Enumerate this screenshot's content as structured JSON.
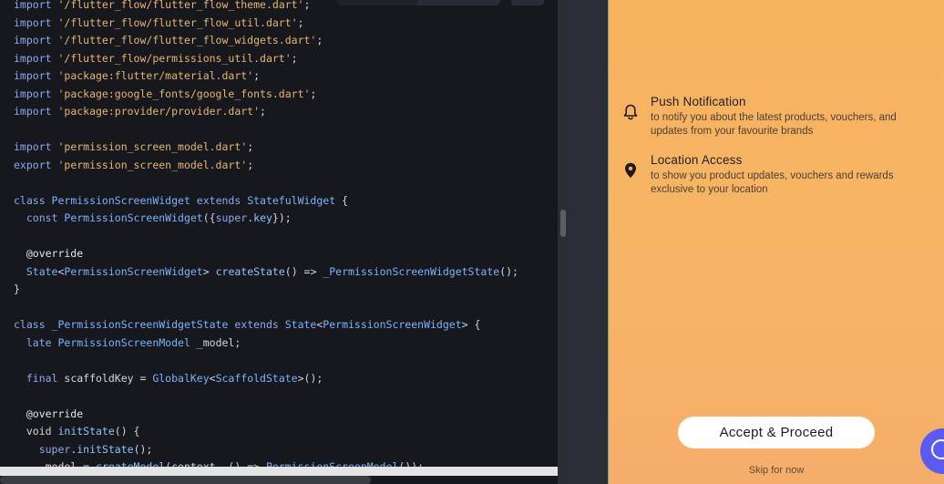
{
  "editor": {
    "lines": [
      [
        {
          "t": "import ",
          "c": "kw"
        },
        {
          "t": "'/flutter_flow/flutter_flow_theme.dart'",
          "c": "str"
        },
        {
          "t": ";",
          "c": "op"
        }
      ],
      [
        {
          "t": "import ",
          "c": "kw"
        },
        {
          "t": "'/flutter_flow/flutter_flow_util.dart'",
          "c": "str"
        },
        {
          "t": ";",
          "c": "op"
        }
      ],
      [
        {
          "t": "import ",
          "c": "kw"
        },
        {
          "t": "'/flutter_flow/flutter_flow_widgets.dart'",
          "c": "str"
        },
        {
          "t": ";",
          "c": "op"
        }
      ],
      [
        {
          "t": "import ",
          "c": "kw"
        },
        {
          "t": "'/flutter_flow/permissions_util.dart'",
          "c": "str"
        },
        {
          "t": ";",
          "c": "op"
        }
      ],
      [
        {
          "t": "import ",
          "c": "kw"
        },
        {
          "t": "'package:flutter/material.dart'",
          "c": "str"
        },
        {
          "t": ";",
          "c": "op"
        }
      ],
      [
        {
          "t": "import ",
          "c": "kw"
        },
        {
          "t": "'package:google_fonts/google_fonts.dart'",
          "c": "str"
        },
        {
          "t": ";",
          "c": "op"
        }
      ],
      [
        {
          "t": "import ",
          "c": "kw"
        },
        {
          "t": "'package:provider/provider.dart'",
          "c": "str"
        },
        {
          "t": ";",
          "c": "op"
        }
      ],
      [],
      [
        {
          "t": "import ",
          "c": "kw"
        },
        {
          "t": "'permission_screen_model.dart'",
          "c": "str"
        },
        {
          "t": ";",
          "c": "op"
        }
      ],
      [
        {
          "t": "export ",
          "c": "kw"
        },
        {
          "t": "'permission_screen_model.dart'",
          "c": "str"
        },
        {
          "t": ";",
          "c": "op"
        }
      ],
      [],
      [
        {
          "t": "class ",
          "c": "kw"
        },
        {
          "t": "PermissionScreenWidget ",
          "c": "ty"
        },
        {
          "t": "extends ",
          "c": "kw"
        },
        {
          "t": "StatefulWidget",
          "c": "ty"
        },
        {
          "t": " {",
          "c": "op"
        }
      ],
      [
        {
          "t": "  const ",
          "c": "kw"
        },
        {
          "t": "PermissionScreenWidget",
          "c": "ty"
        },
        {
          "t": "({",
          "c": "op"
        },
        {
          "t": "super",
          "c": "kw"
        },
        {
          "t": ".",
          "c": "op"
        },
        {
          "t": "key",
          "c": "fn"
        },
        {
          "t": "});",
          "c": "op"
        }
      ],
      [],
      [
        {
          "t": "  @override",
          "c": "an"
        }
      ],
      [
        {
          "t": "  State",
          "c": "ty"
        },
        {
          "t": "<",
          "c": "op"
        },
        {
          "t": "PermissionScreenWidget",
          "c": "ty"
        },
        {
          "t": "> ",
          "c": "op"
        },
        {
          "t": "createState",
          "c": "fn"
        },
        {
          "t": "() => ",
          "c": "op"
        },
        {
          "t": "_PermissionScreenWidgetState",
          "c": "ty"
        },
        {
          "t": "();",
          "c": "op"
        }
      ],
      [
        {
          "t": "}",
          "c": "op"
        }
      ],
      [],
      [
        {
          "t": "class ",
          "c": "kw"
        },
        {
          "t": "_PermissionScreenWidgetState ",
          "c": "ty"
        },
        {
          "t": "extends ",
          "c": "kw"
        },
        {
          "t": "State",
          "c": "ty"
        },
        {
          "t": "<",
          "c": "op"
        },
        {
          "t": "PermissionScreenWidget",
          "c": "ty"
        },
        {
          "t": "> {",
          "c": "op"
        }
      ],
      [
        {
          "t": "  late ",
          "c": "kw"
        },
        {
          "t": "PermissionScreenModel ",
          "c": "ty"
        },
        {
          "t": "_model;",
          "c": "op"
        }
      ],
      [],
      [
        {
          "t": "  final ",
          "c": "kw"
        },
        {
          "t": "scaffoldKey = ",
          "c": "op"
        },
        {
          "t": "GlobalKey",
          "c": "ty"
        },
        {
          "t": "<",
          "c": "op"
        },
        {
          "t": "ScaffoldState",
          "c": "ty"
        },
        {
          "t": ">();",
          "c": "op"
        }
      ],
      [],
      [
        {
          "t": "  @override",
          "c": "an"
        }
      ],
      [
        {
          "t": "  void ",
          "c": "op"
        },
        {
          "t": "initState",
          "c": "fn"
        },
        {
          "t": "() {",
          "c": "op"
        }
      ],
      [
        {
          "t": "    super",
          "c": "kw"
        },
        {
          "t": ".",
          "c": "op"
        },
        {
          "t": "initState",
          "c": "fn"
        },
        {
          "t": "();",
          "c": "op"
        }
      ],
      [
        {
          "t": "    _model = ",
          "c": "op"
        },
        {
          "t": "createModel",
          "c": "fn"
        },
        {
          "t": "(context, () => ",
          "c": "op"
        },
        {
          "t": "PermissionScreenModel",
          "c": "ty"
        },
        {
          "t": "());",
          "c": "op"
        }
      ]
    ]
  },
  "preview": {
    "permissions": [
      {
        "icon": "bell-icon",
        "title": "Push Notification",
        "desc": "to notify you about the latest products, vouchers, and updates from your favourite brands"
      },
      {
        "icon": "location-pin-icon",
        "title": "Location Access",
        "desc": "to show you product updates, vouchers and rewards exclusive to your location"
      }
    ],
    "accept_label": "Accept & Proceed",
    "skip_label": "Skip for now"
  },
  "colors": {
    "accent": "#f7b25f",
    "fab": "#5b5bf0"
  }
}
